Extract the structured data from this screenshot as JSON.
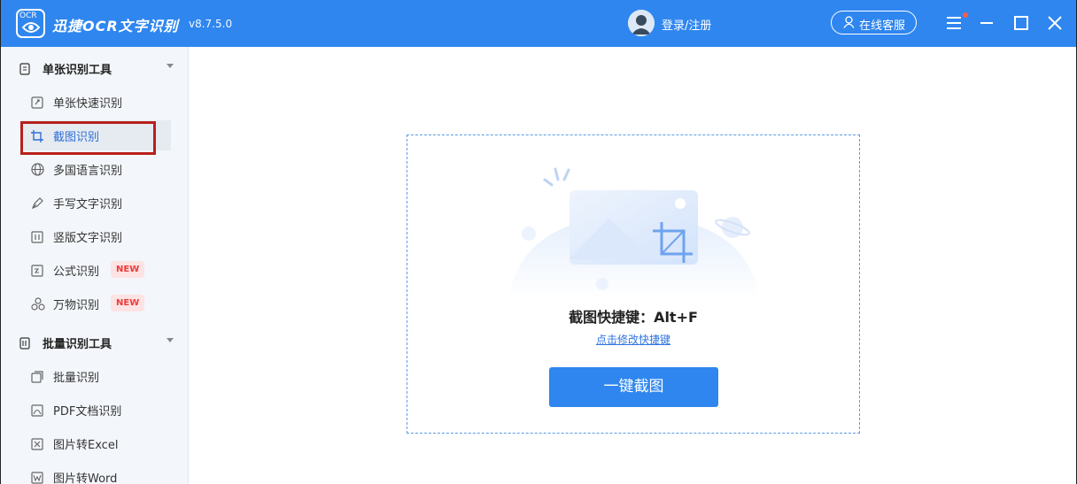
{
  "app": {
    "logo_text": "OCR",
    "title": "迅捷OCR文字识别",
    "version": "v8.7.5.0"
  },
  "header": {
    "login_label": "登录/注册",
    "service_label": "在线客服"
  },
  "sidebar": {
    "group1": {
      "label": "单张识别工具",
      "items": [
        {
          "label": "单张快速识别"
        },
        {
          "label": "截图识别"
        },
        {
          "label": "多国语言识别"
        },
        {
          "label": "手写文字识别"
        },
        {
          "label": "竖版文字识别"
        },
        {
          "label": "公式识别",
          "badge": "NEW"
        },
        {
          "label": "万物识别",
          "badge": "NEW"
        }
      ]
    },
    "group2": {
      "label": "批量识别工具",
      "items": [
        {
          "label": "批量识别"
        },
        {
          "label": "PDF文档识别"
        },
        {
          "label": "图片转Excel"
        },
        {
          "label": "图片转Word"
        }
      ]
    },
    "selected_item": "截图识别"
  },
  "main": {
    "shortcut_text": "截图快捷键：Alt+F",
    "change_shortcut_link": "点击修改快捷键",
    "capture_button": "一键截图"
  },
  "colors": {
    "brand_blue": "#2f86ef",
    "sidebar_bg": "#f3f6fa",
    "highlight_red": "#b8201c",
    "badge_text": "#ef3b3b"
  }
}
